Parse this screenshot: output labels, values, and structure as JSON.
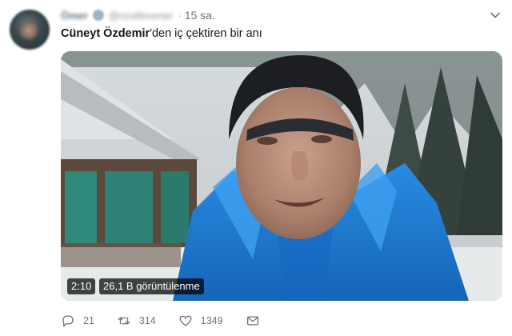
{
  "tweet": {
    "author": {
      "display_name": "Ömer",
      "handle": "@ozaltinomer"
    },
    "dot": "·",
    "timestamp": "15 sa.",
    "text": {
      "bold": "Cüneyt Özdemir",
      "rest": "'den iç çektiren bir anı"
    },
    "video": {
      "duration": "2:10",
      "views": "26,1 B görüntülenme"
    },
    "actions": {
      "replies": "21",
      "retweets": "314",
      "likes": "1349"
    }
  },
  "icons": {
    "caret": "chevron-down-icon",
    "verified": "verified-badge-icon",
    "reply": "reply-icon",
    "retweet": "retweet-icon",
    "like": "heart-icon",
    "dm": "mail-icon"
  },
  "colors": {
    "text_primary": "#14171a",
    "text_secondary": "#657786",
    "jacket_blue": "#1f7fd6"
  }
}
